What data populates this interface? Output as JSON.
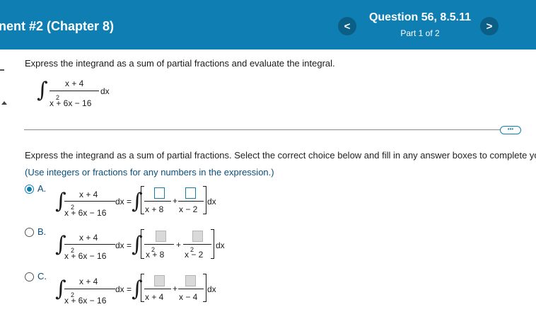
{
  "header": {
    "title": "nent #2 (Chapter 8)",
    "prev_label": "<",
    "next_label": ">",
    "question_label": "Question 56, 8.5.11",
    "part_label": "Part 1 of 2"
  },
  "problem": {
    "instruction": "Express the integrand as a sum of partial fractions and evaluate the integral.",
    "numerator": "x + 4",
    "denominator": "x + 6x − 16",
    "denominator_exp": "2",
    "dx": "dx"
  },
  "more_label": "•••",
  "part1": {
    "instruction": "Express the integrand as a sum of partial fractions. Select the correct choice below and fill in any answer boxes to complete yo",
    "hint": "(Use integers or fractions for any numbers in the expression.)"
  },
  "choices": [
    {
      "label": "A.",
      "selected": true,
      "lhs_num": "x + 4",
      "lhs_den": "x + 6x − 16",
      "lhs_exp": "2",
      "eq": "dx =",
      "den1": "x + 8",
      "den2": "x − 2",
      "plus": "+",
      "dx": "dx"
    },
    {
      "label": "B.",
      "selected": false,
      "lhs_num": "x + 4",
      "lhs_den": "x + 6x − 16",
      "lhs_exp": "2",
      "eq": "dx =",
      "den1": "x + 8",
      "den1_exp": "2",
      "den2": "x − 2",
      "den2_exp": "2",
      "plus": "+",
      "dx": "dx"
    },
    {
      "label": "C.",
      "selected": false,
      "lhs_num": "x + 4",
      "lhs_den": "x + 6x − 16",
      "lhs_exp": "2",
      "eq": "dx =",
      "den1": "x + 4",
      "den2": "x − 4",
      "plus": "+",
      "dx": "dx"
    }
  ],
  "colors": {
    "header_bg": "#0f7fb3",
    "nav_btn": "#0b5e86",
    "accent": "#0f7fb3"
  }
}
